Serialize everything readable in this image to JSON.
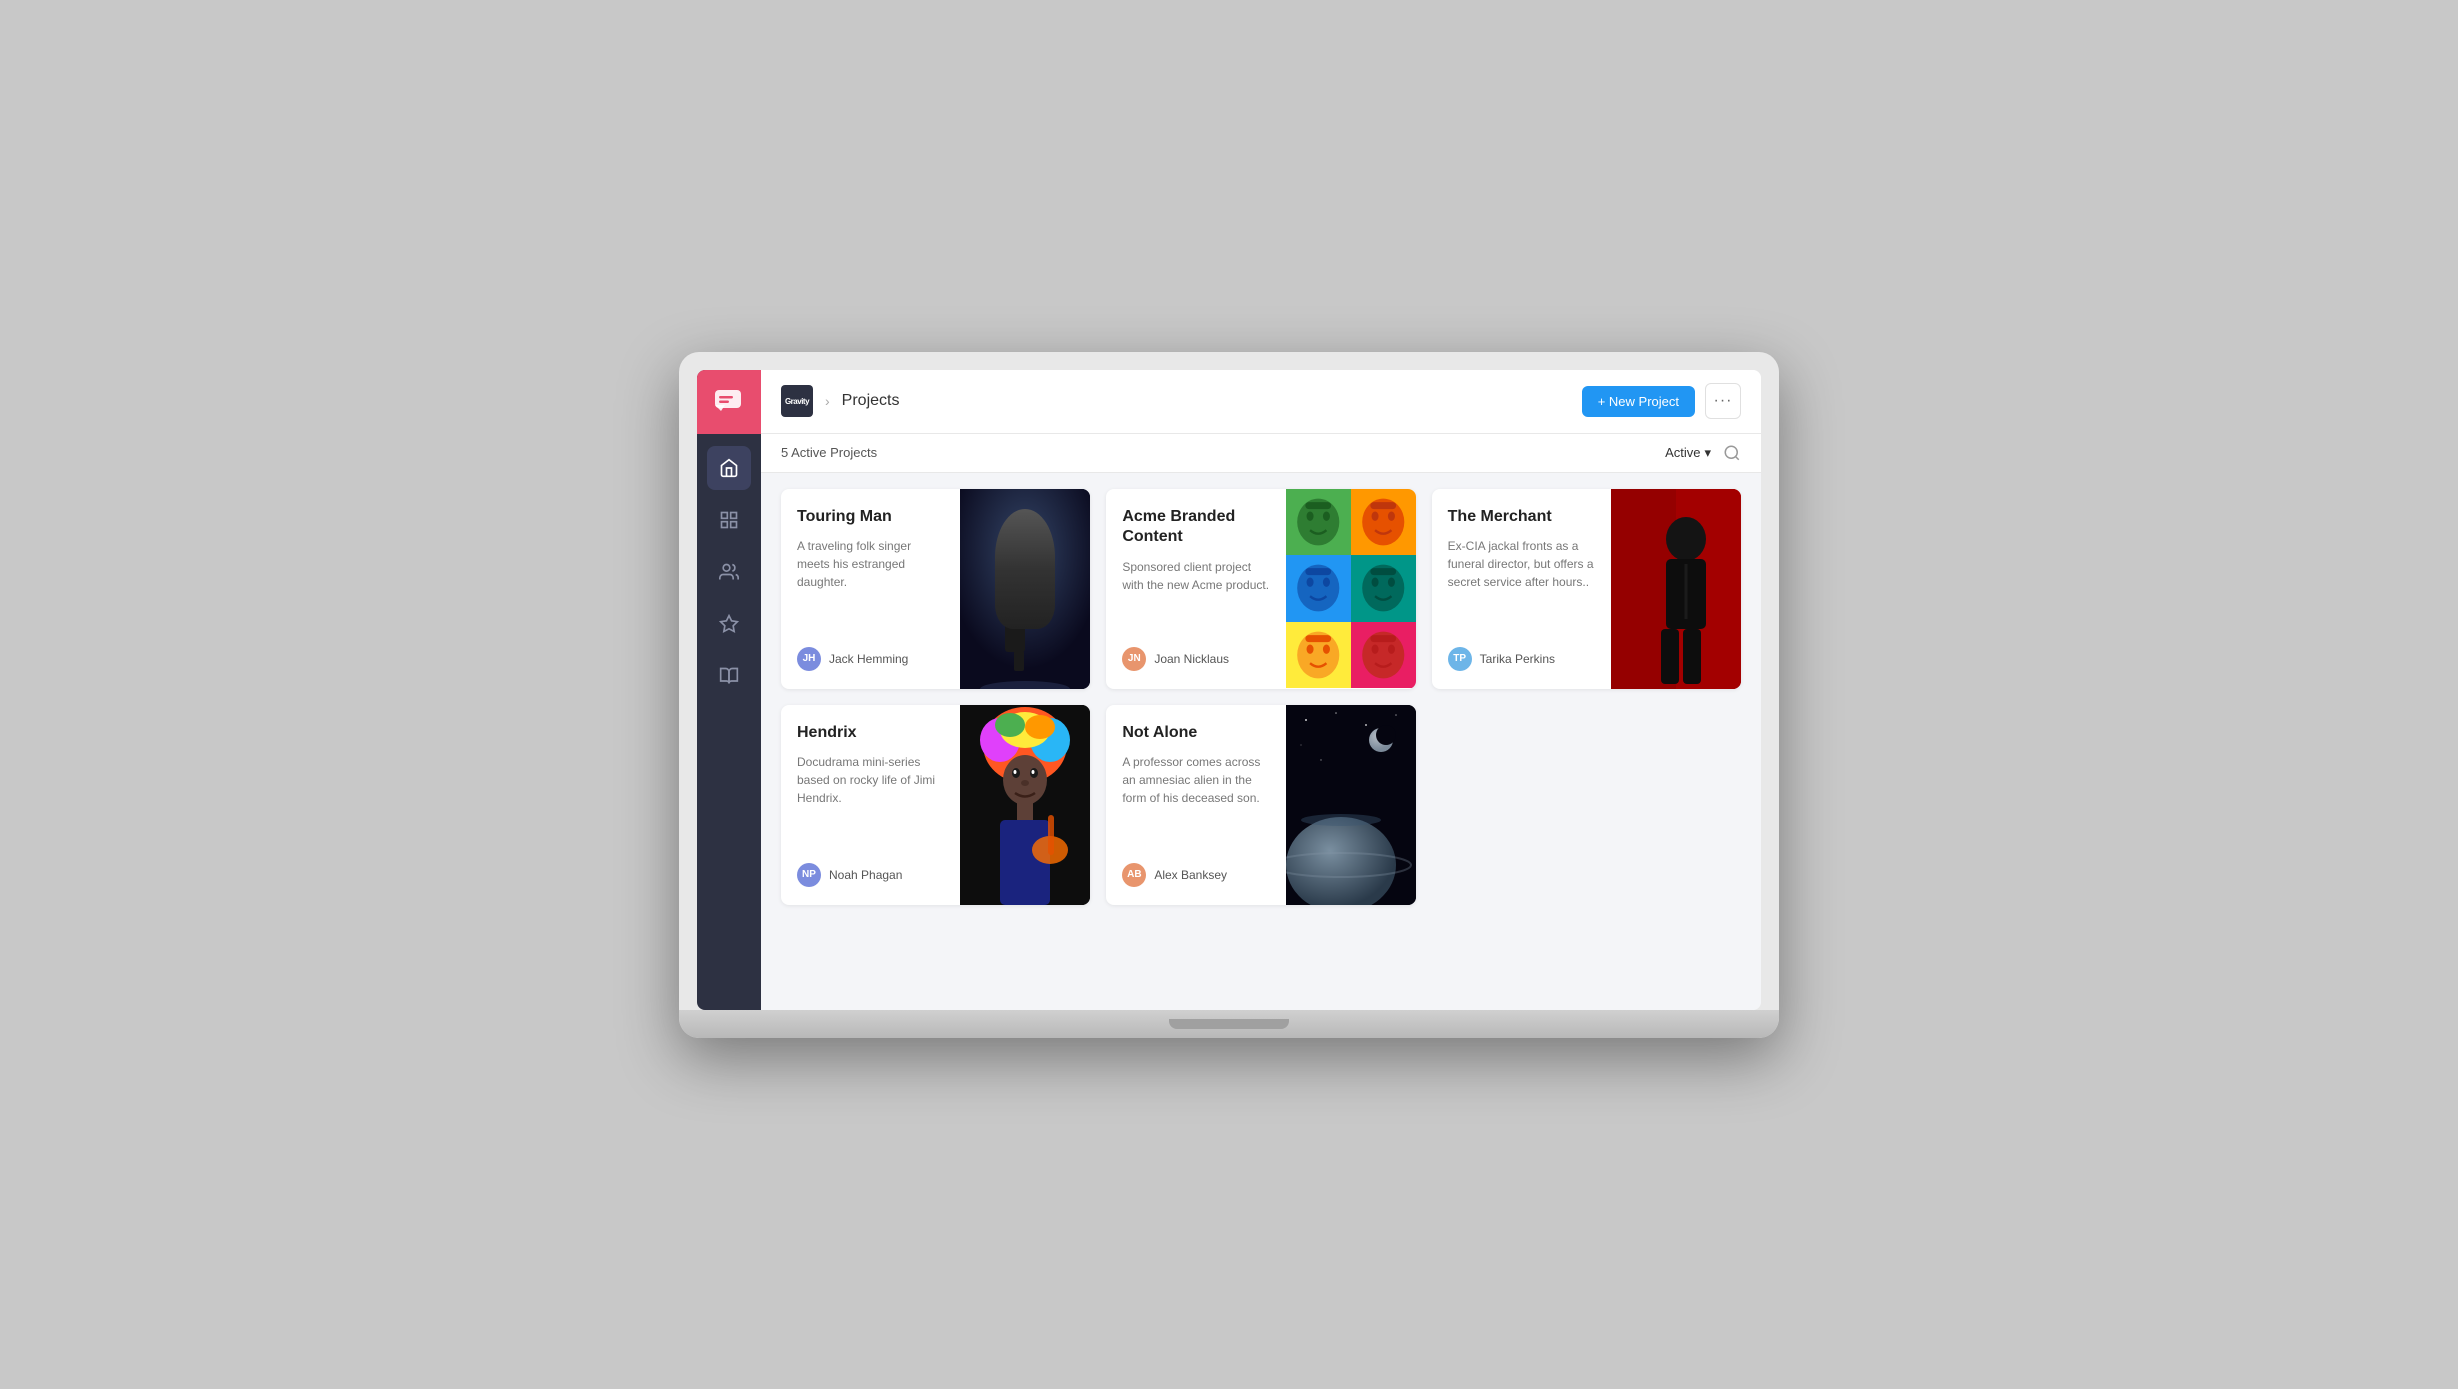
{
  "header": {
    "logo_text": "Gravity",
    "separator": "/",
    "title": "Projects",
    "new_project_label": "+ New Project",
    "more_label": "···"
  },
  "sub_header": {
    "count_label": "5 Active Projects",
    "filter_label": "Active",
    "chevron": "▾"
  },
  "projects": [
    {
      "id": "touring-man",
      "title": "Touring Man",
      "description": "A traveling folk singer meets his estranged daughter.",
      "author_name": "Jack Hemming",
      "author_initials": "JH",
      "author_color": "#7b8cde",
      "image_type": "touring"
    },
    {
      "id": "acme-branded",
      "title": "Acme Branded Content",
      "description": "Sponsored client project with the new Acme product.",
      "author_name": "Joan Nicklaus",
      "author_initials": "JN",
      "author_color": "#e8956d",
      "image_type": "acme"
    },
    {
      "id": "the-merchant",
      "title": "The Merchant",
      "description": "Ex-CIA jackal fronts as a funeral director, but offers a secret service after hours..",
      "author_name": "Tarika Perkins",
      "author_initials": "TP",
      "author_color": "#6db5e8",
      "image_type": "merchant"
    },
    {
      "id": "hendrix",
      "title": "Hendrix",
      "description": "Docudrama mini-series based on rocky life of Jimi Hendrix.",
      "author_name": "Noah Phagan",
      "author_initials": "NP",
      "author_color": "#7b8cde",
      "image_type": "hendrix"
    },
    {
      "id": "not-alone",
      "title": "Not Alone",
      "description": "A professor comes across an amnesiac alien in the form of his deceased son.",
      "author_name": "Alex Banksey",
      "author_initials": "AB",
      "author_color": "#e8956d",
      "image_type": "not-alone"
    }
  ],
  "sidebar": {
    "nav_items": [
      {
        "name": "home",
        "label": "Home"
      },
      {
        "name": "grid",
        "label": "Grid"
      },
      {
        "name": "users",
        "label": "Users"
      },
      {
        "name": "vip",
        "label": "VIP"
      },
      {
        "name": "book",
        "label": "Book"
      }
    ]
  }
}
